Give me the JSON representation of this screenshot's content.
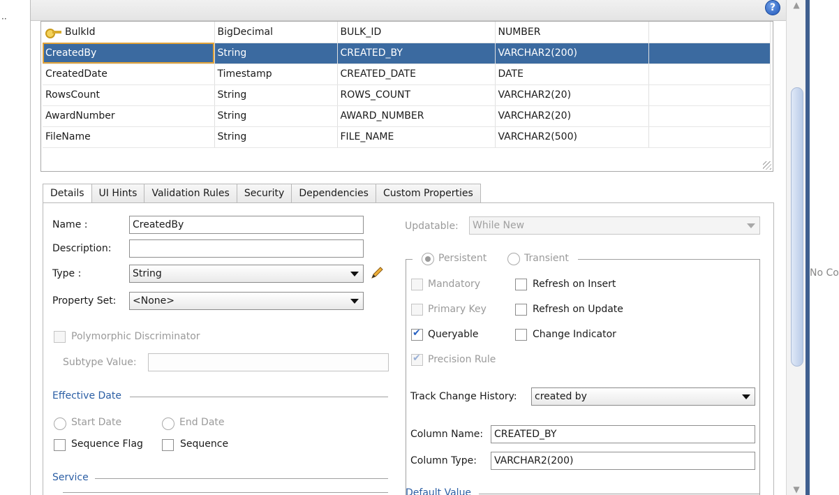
{
  "gutter": {
    "marker": "··"
  },
  "help": {
    "glyph": "?"
  },
  "side": {
    "truncated_text": "No Co"
  },
  "table": {
    "rows": [
      {
        "name": "BulkId",
        "type": "BigDecimal",
        "column": "BULK_ID",
        "sql_type": "NUMBER",
        "key": true
      },
      {
        "name": "CreatedBy",
        "type": "String",
        "column": "CREATED_BY",
        "sql_type": "VARCHAR2(200)",
        "selected": true
      },
      {
        "name": "CreatedDate",
        "type": "Timestamp",
        "column": "CREATED_DATE",
        "sql_type": "DATE"
      },
      {
        "name": "RowsCount",
        "type": "String",
        "column": "ROWS_COUNT",
        "sql_type": "VARCHAR2(20)"
      },
      {
        "name": "AwardNumber",
        "type": "String",
        "column": "AWARD_NUMBER",
        "sql_type": "VARCHAR2(20)"
      },
      {
        "name": "FileName",
        "type": "String",
        "column": "FILE_NAME",
        "sql_type": "VARCHAR2(500)"
      }
    ]
  },
  "tabs": [
    {
      "label": "Details",
      "active": true
    },
    {
      "label": "UI Hints"
    },
    {
      "label": "Validation Rules"
    },
    {
      "label": "Security"
    },
    {
      "label": "Dependencies"
    },
    {
      "label": "Custom Properties"
    }
  ],
  "details": {
    "name_label": "Name :",
    "name_value": "CreatedBy",
    "description_label": "Description:",
    "description_value": "",
    "type_label": "Type :",
    "type_value": "String",
    "property_set_label": "Property Set:",
    "property_set_value": "<None>",
    "polymorphic_label": "Polymorphic Discriminator",
    "subtype_label": "Subtype Value:",
    "subtype_value": "",
    "effective_date_label": "Effective Date",
    "start_date_label": "Start Date",
    "end_date_label": "End Date",
    "sequence_flag_label": "Sequence Flag",
    "sequence_label": "Sequence",
    "service_label": "Service",
    "updatable_label": "Updatable:",
    "updatable_value": "While New",
    "persistent_label": "Persistent",
    "transient_label": "Transient",
    "mandatory_label": "Mandatory",
    "refresh_insert_label": "Refresh on Insert",
    "primary_key_label": "Primary Key",
    "refresh_update_label": "Refresh on Update",
    "queryable_label": "Queryable",
    "change_indicator_label": "Change Indicator",
    "precision_rule_label": "Precision Rule",
    "track_change_label": "Track Change History:",
    "track_change_value": "created by",
    "column_name_label": "Column Name:",
    "column_name_value": "CREATED_BY",
    "column_type_label": "Column Type:",
    "column_type_value": "VARCHAR2(200)",
    "default_value_label": "Default Value"
  }
}
